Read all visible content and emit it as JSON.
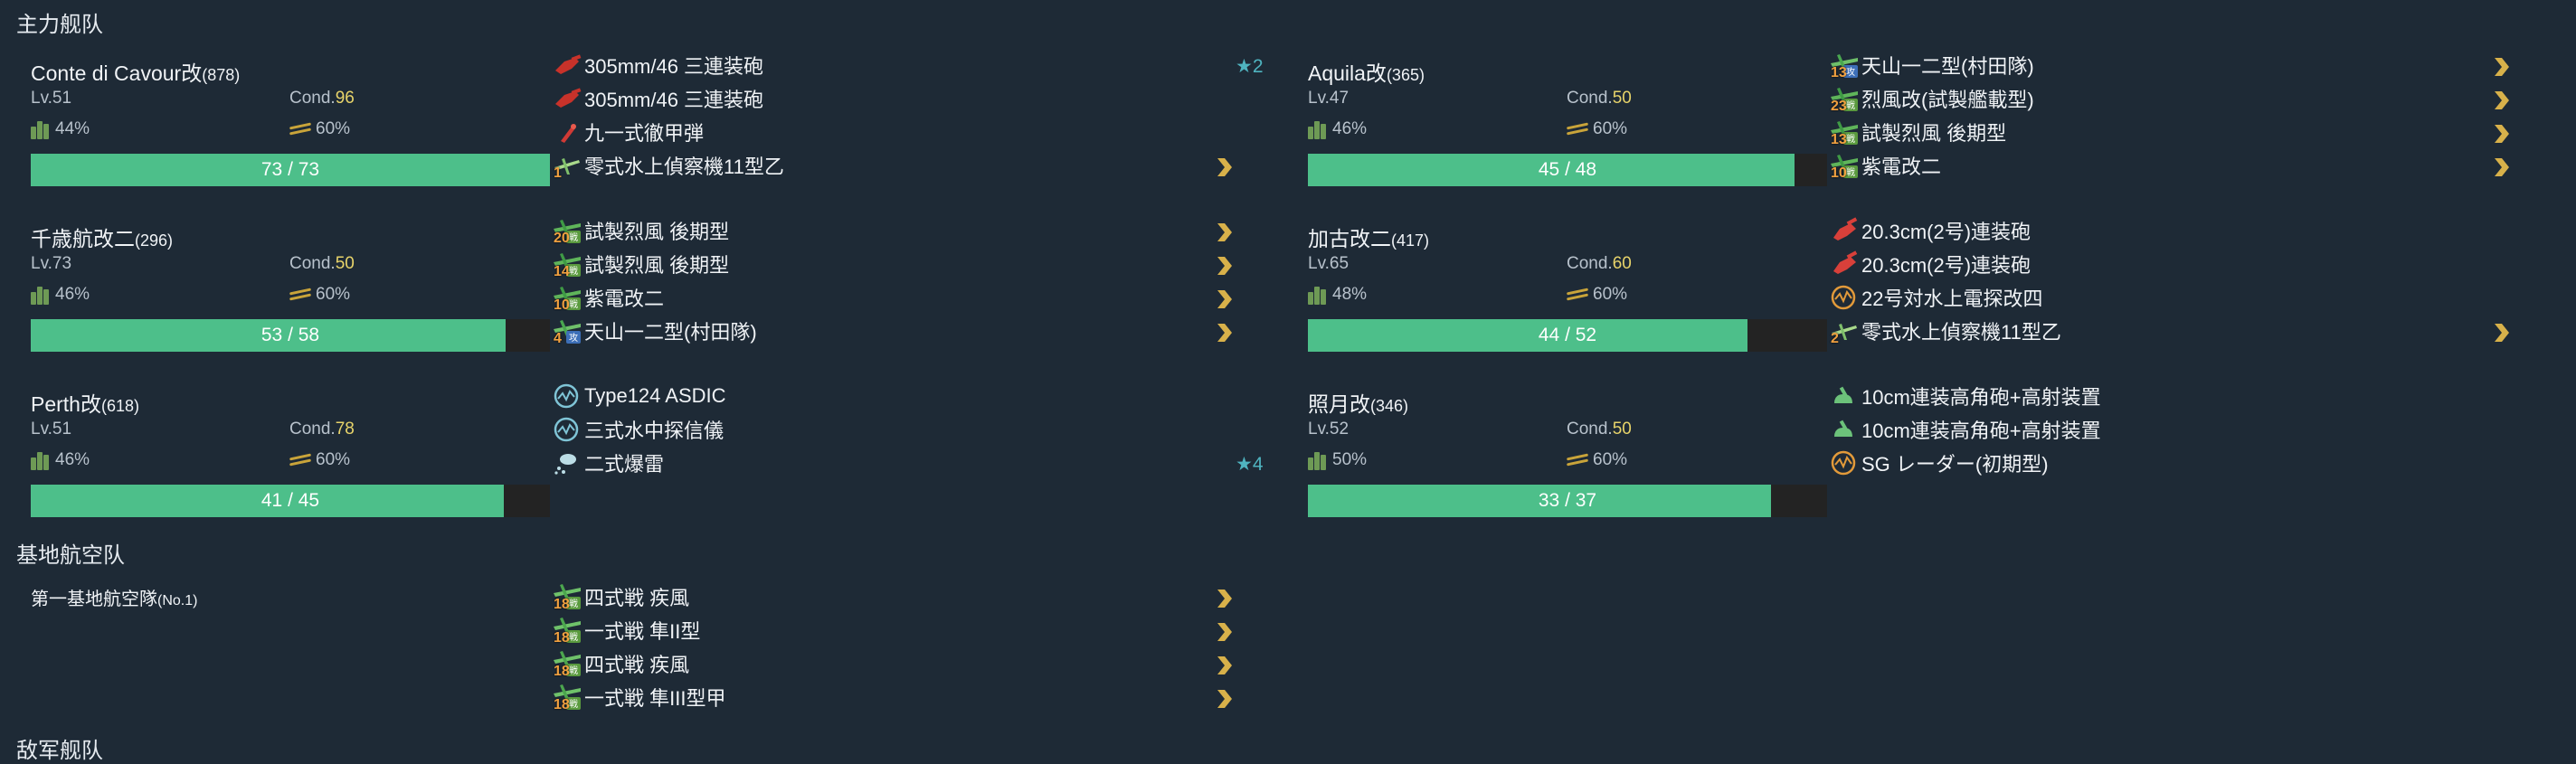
{
  "colors": {
    "background": "#1e2a36",
    "hp_fill": "#4dbf8a",
    "hp_track": "#232323",
    "cond": "#e8d46a",
    "chevron": "#d8b14a",
    "star": "#4fb4c0"
  },
  "sections": {
    "main_fleet": "主力舰队",
    "base_air": "基地航空队",
    "enemy_fleet": "敌军舰队"
  },
  "labels": {
    "cond": "Cond."
  },
  "ships": [
    {
      "name": "Conte di Cavour改",
      "id": "(878)",
      "level": "Lv.51",
      "cond": "96",
      "fuel": "44%",
      "ammo": "60%",
      "hp": "73 / 73",
      "hp_ratio": 1.0,
      "equips": [
        {
          "icon": "main-gun-icon",
          "name": "305mm/46 三連装砲",
          "star": "★2"
        },
        {
          "icon": "main-gun-icon",
          "name": "305mm/46 三連装砲"
        },
        {
          "icon": "ap-shell-icon",
          "name": "九一式徹甲弾"
        },
        {
          "icon": "seaplane-icon",
          "slot": "1",
          "name": "零式水上偵察機11型乙",
          "chevron": true
        }
      ]
    },
    {
      "name": "Aquila改",
      "id": "(365)",
      "level": "Lv.47",
      "cond": "50",
      "fuel": "46%",
      "ammo": "60%",
      "hp": "45 / 48",
      "hp_ratio": 0.9375,
      "equips": [
        {
          "icon": "torpedo-bomber-icon",
          "slot": "13",
          "badge": "攻",
          "name": "天山一二型(村田隊)",
          "chevron": true
        },
        {
          "icon": "fighter-icon",
          "slot": "23",
          "badge": "戦",
          "name": "烈風改(試製艦載型)",
          "chevron": true
        },
        {
          "icon": "fighter-icon",
          "slot": "13",
          "badge": "戦",
          "name": "試製烈風 後期型",
          "chevron": true
        },
        {
          "icon": "fighter-icon",
          "slot": "10",
          "badge": "戦",
          "name": "紫電改二",
          "chevron": true
        }
      ]
    },
    {
      "name": "千歳航改二",
      "id": "(296)",
      "level": "Lv.73",
      "cond": "50",
      "fuel": "46%",
      "ammo": "60%",
      "hp": "53 / 58",
      "hp_ratio": 0.914,
      "equips": [
        {
          "icon": "fighter-icon",
          "slot": "20",
          "badge": "戦",
          "name": "試製烈風 後期型",
          "chevron": true
        },
        {
          "icon": "fighter-icon",
          "slot": "14",
          "badge": "戦",
          "name": "試製烈風 後期型",
          "chevron": true
        },
        {
          "icon": "fighter-icon",
          "slot": "10",
          "badge": "戦",
          "name": "紫電改二",
          "chevron": true
        },
        {
          "icon": "torpedo-bomber-icon",
          "slot": "4",
          "badge": "攻",
          "name": "天山一二型(村田隊)",
          "chevron": true
        }
      ]
    },
    {
      "name": "加古改二",
      "id": "(417)",
      "level": "Lv.65",
      "cond": "60",
      "fuel": "48%",
      "ammo": "60%",
      "hp": "44 / 52",
      "hp_ratio": 0.846,
      "equips": [
        {
          "icon": "medium-gun-icon",
          "name": "20.3cm(2号)連装砲"
        },
        {
          "icon": "medium-gun-icon",
          "name": "20.3cm(2号)連装砲"
        },
        {
          "icon": "radar-icon",
          "name": "22号対水上電探改四"
        },
        {
          "icon": "seaplane-icon",
          "slot": "2",
          "name": "零式水上偵察機11型乙",
          "chevron": true
        }
      ]
    },
    {
      "name": "Perth改",
      "id": "(618)",
      "level": "Lv.51",
      "cond": "78",
      "fuel": "46%",
      "ammo": "60%",
      "hp": "41 / 45",
      "hp_ratio": 0.911,
      "equips": [
        {
          "icon": "sonar-icon",
          "name": "Type124 ASDIC"
        },
        {
          "icon": "sonar-icon",
          "name": "三式水中探信儀"
        },
        {
          "icon": "depth-charge-icon",
          "name": "二式爆雷",
          "star": "★4"
        }
      ]
    },
    {
      "name": "照月改",
      "id": "(346)",
      "level": "Lv.52",
      "cond": "50",
      "fuel": "50%",
      "ammo": "60%",
      "hp": "33 / 37",
      "hp_ratio": 0.892,
      "equips": [
        {
          "icon": "aa-gun-icon",
          "name": "10cm連装高角砲+高射装置"
        },
        {
          "icon": "aa-gun-icon",
          "name": "10cm連装高角砲+高射装置"
        },
        {
          "icon": "radar-icon",
          "name": "SG レーダー(初期型)"
        }
      ]
    }
  ],
  "base_air": {
    "name": "第一基地航空隊",
    "id": "(No.1)",
    "equips": [
      {
        "icon": "land-fighter-icon",
        "slot": "18",
        "badge": "戦",
        "name": "四式戦 疾風",
        "chevron": true
      },
      {
        "icon": "land-fighter-icon",
        "slot": "18",
        "badge": "戦",
        "name": "一式戦 隼II型",
        "chevron": true
      },
      {
        "icon": "land-fighter-icon",
        "slot": "18",
        "badge": "戦",
        "name": "四式戦 疾風",
        "chevron": true
      },
      {
        "icon": "land-fighter-icon",
        "slot": "18",
        "badge": "戦",
        "name": "一式戦 隼III型甲",
        "chevron": true
      }
    ]
  }
}
